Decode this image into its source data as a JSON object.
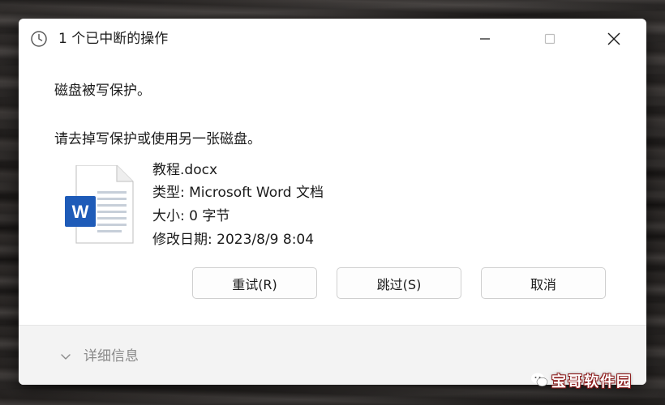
{
  "window": {
    "title": "1 个已中断的操作",
    "icons": {
      "title": "clock-icon",
      "minimize": "minimize-icon",
      "maximize": "maximize-icon",
      "close": "close-icon"
    }
  },
  "message": {
    "line1": "磁盘被写保护。",
    "line2": "请去掉写保护或使用另一张磁盘。"
  },
  "file": {
    "icon": "word-document-icon",
    "name": "教程.docx",
    "type": "类型: Microsoft Word 文档",
    "size": "大小: 0 字节",
    "modified": "修改日期: 2023/8/9 8:04"
  },
  "buttons": {
    "retry": "重试(R)",
    "skip": "跳过(S)",
    "cancel": "取消"
  },
  "footer": {
    "details_label": "详细信息",
    "icon": "chevron-down-icon"
  },
  "watermark": {
    "text": "宝哥软件园",
    "icon": "wechat-icon"
  },
  "colors": {
    "word_blue": "#1e5bb8",
    "footer_bg": "#f3f3f3",
    "details_gray": "#8a8a8a"
  }
}
